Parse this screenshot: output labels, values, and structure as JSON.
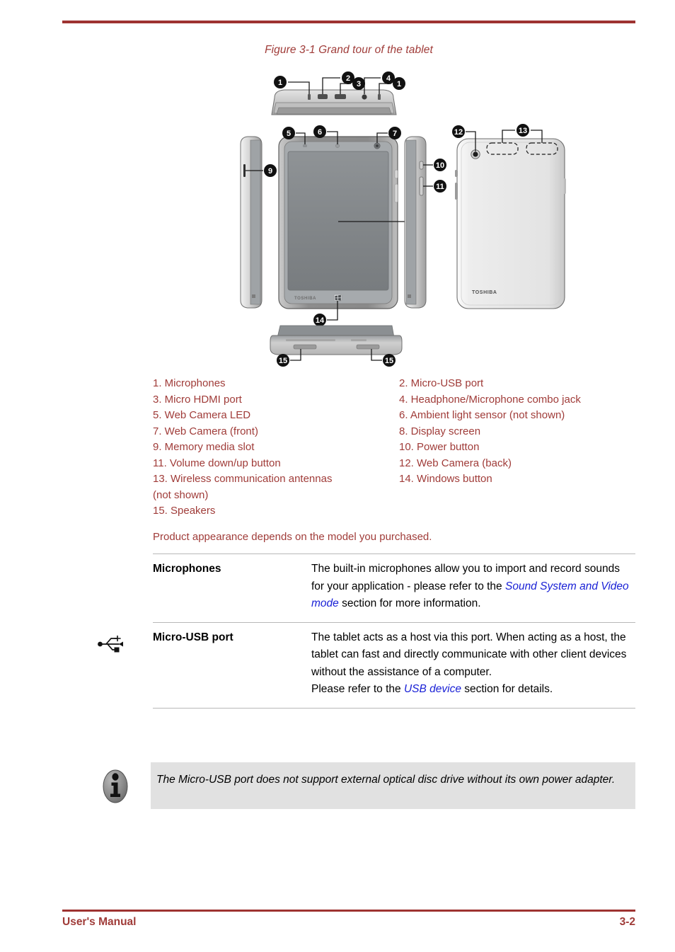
{
  "document": {
    "figure_caption": "Figure 3-1 Grand tour of the tablet",
    "appearance_note": "Product appearance depends on the model you purchased.",
    "footer_left": "User's Manual",
    "footer_page": "3-2"
  },
  "colors": {
    "accent_red": "#9e3331",
    "text_red": "#a03c39",
    "link_blue": "#1a21d6",
    "note_background": "#e1e1e1",
    "callout_badge": "#111111"
  },
  "figure": {
    "brand": "TOSHIBA",
    "callouts": [
      {
        "number": "1",
        "label": "Microphones"
      },
      {
        "number": "2",
        "label": "Micro-USB port"
      },
      {
        "number": "3",
        "label": "Micro HDMI port"
      },
      {
        "number": "4",
        "label": "Headphone/Microphone combo jack"
      },
      {
        "number": "5",
        "label": "Web Camera LED"
      },
      {
        "number": "6",
        "label": "Ambient light sensor (not shown)"
      },
      {
        "number": "7",
        "label": "Web Camera (front)"
      },
      {
        "number": "8",
        "label": "Display screen"
      },
      {
        "number": "9",
        "label": "Memory media slot"
      },
      {
        "number": "10",
        "label": "Power button"
      },
      {
        "number": "11",
        "label": "Volume down/up button"
      },
      {
        "number": "12",
        "label": "Web Camera (back)"
      },
      {
        "number": "13",
        "label": "Wireless communication antennas (not shown)"
      },
      {
        "number": "14",
        "label": "Windows button"
      },
      {
        "number": "15",
        "label": "Speakers"
      }
    ]
  },
  "legend": {
    "left_column": [
      "1. Microphones",
      "3. Micro HDMI port",
      "5. Web Camera LED",
      "7. Web Camera (front)",
      "9. Memory media slot",
      "11. Volume down/up button",
      "13. Wireless communication antennas\n(not shown)",
      "15. Speakers"
    ],
    "right_column": [
      "2. Micro-USB port",
      "4. Headphone/Microphone combo jack",
      "6. Ambient light sensor (not shown)",
      "8. Display screen",
      "10. Power button",
      "12. Web Camera (back)",
      "14. Windows button"
    ]
  },
  "definitions": [
    {
      "term": "Microphones",
      "icon": "",
      "text_before": "The built-in microphones allow you to import and record sounds for your application - please refer to the ",
      "link": "Sound System and Video mode",
      "text_after": " section for more information.",
      "extra_lines": []
    },
    {
      "term": "Micro-USB port",
      "icon": "usb-icon",
      "text_before": "The tablet acts as a host via this port. When acting as a host, the tablet can fast and directly communicate with other client devices without the assistance of a computer.",
      "link": "USB device",
      "text_after": " section for details.",
      "second_line_prefix": "Please refer to the ",
      "extra_lines": []
    }
  ],
  "note": {
    "icon": "info-icon",
    "text": "The Micro-USB port does not support external optical disc drive without its own power adapter."
  }
}
